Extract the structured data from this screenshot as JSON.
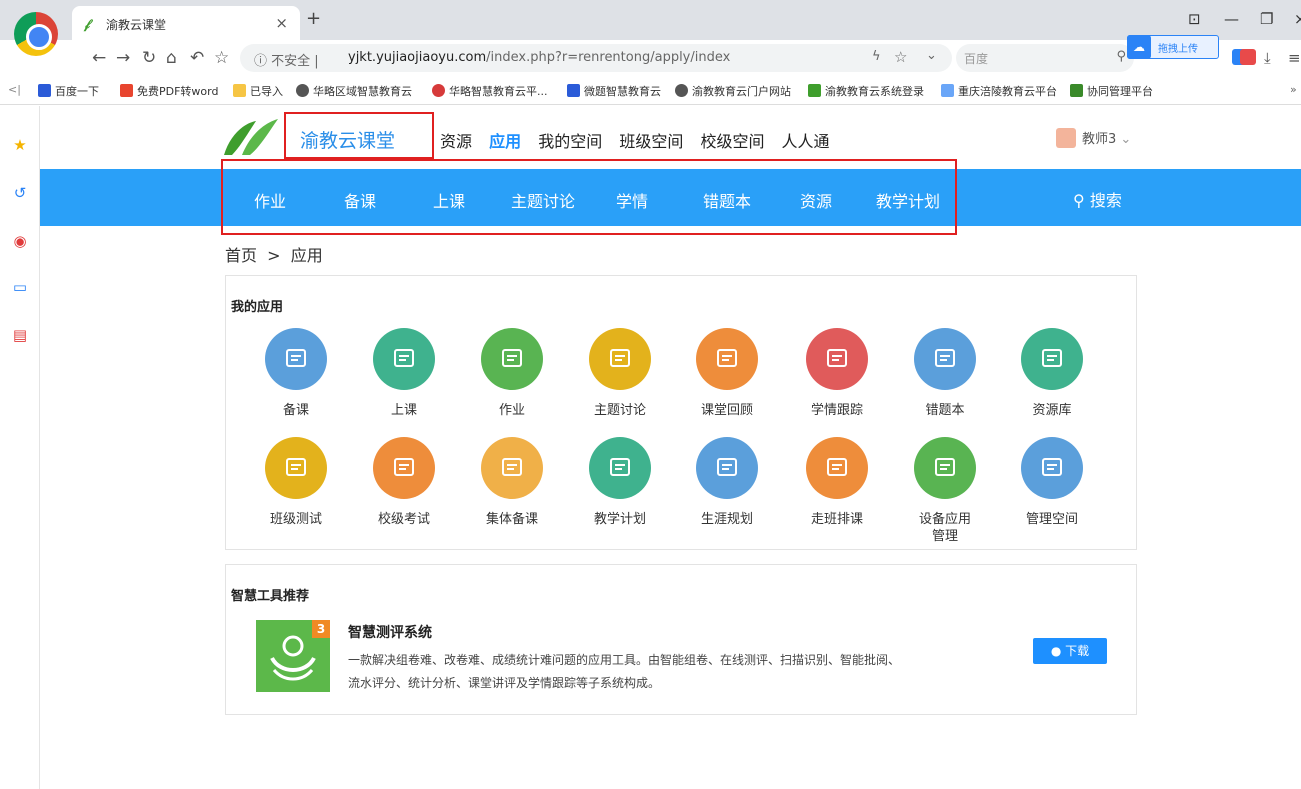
{
  "browser": {
    "tab_title": "渝教云课堂",
    "url_secure_label": "ⓘ 不安全 |",
    "url_domain": "yjkt.yujiaojiaoyu.com",
    "url_path": "/index.php?r=renrentong/apply/index",
    "search_engine": "百度",
    "upload_label": "拖拽上传"
  },
  "bookmarks": [
    "百度一下",
    "免费PDF转word",
    "已导入",
    "华略区域智慧教育云",
    "华略智慧教育云平...",
    "微题智慧教育云",
    "渝教教育云门户网站",
    "渝教教育云系统登录",
    "重庆涪陵教育云平台",
    "协同管理平台"
  ],
  "site": {
    "name": "渝教云课堂",
    "top_nav": [
      "资源",
      "应用",
      "我的空间",
      "班级空间",
      "校级空间",
      "人人通"
    ],
    "active_nav": "应用",
    "user": "教师3",
    "sub_nav": [
      "作业",
      "备课",
      "上课",
      "主题讨论",
      "学情",
      "错题本",
      "资源",
      "教学计划"
    ],
    "search": "搜索",
    "breadcrumb": "首页  >  应用"
  },
  "my_apps": {
    "title": "我的应用",
    "rows": [
      [
        {
          "label": "备课",
          "color": "#5b9fdb",
          "icon": "lesson-prep-icon"
        },
        {
          "label": "上课",
          "color": "#3fb28e",
          "icon": "teaching-icon"
        },
        {
          "label": "作业",
          "color": "#59b452",
          "icon": "homework-icon"
        },
        {
          "label": "主题讨论",
          "color": "#e3b21c",
          "icon": "discussion-icon"
        },
        {
          "label": "课堂回顾",
          "color": "#ee8d3b",
          "icon": "class-review-icon"
        },
        {
          "label": "学情跟踪",
          "color": "#e05b5b",
          "icon": "tracking-icon"
        },
        {
          "label": "错题本",
          "color": "#5b9fdb",
          "icon": "mistake-book-icon"
        },
        {
          "label": "资源库",
          "color": "#3fb28e",
          "icon": "resource-library-icon"
        }
      ],
      [
        {
          "label": "班级测试",
          "color": "#e3b21c",
          "icon": "class-test-icon"
        },
        {
          "label": "校级考试",
          "color": "#ee8d3b",
          "icon": "school-exam-icon"
        },
        {
          "label": "集体备课",
          "color": "#f0b048",
          "icon": "group-prep-icon"
        },
        {
          "label": "教学计划",
          "color": "#3fb28e",
          "icon": "teaching-plan-icon"
        },
        {
          "label": "生涯规划",
          "color": "#5b9fdb",
          "icon": "career-plan-icon"
        },
        {
          "label": "走班排课",
          "color": "#ee8d3b",
          "icon": "schedule-icon"
        },
        {
          "label": "设备应用管理",
          "color": "#59b452",
          "icon": "device-manage-icon"
        },
        {
          "label": "管理空间",
          "color": "#5b9fdb",
          "icon": "manage-space-icon"
        }
      ]
    ]
  },
  "tools": {
    "title": "智慧工具推荐",
    "item": {
      "badge": "3",
      "name": "智慧测评系统",
      "desc_line1": "一款解决组卷难、改卷难、成绩统计难问题的应用工具。由智能组卷、在线测评、扫描识别、智能批阅、",
      "desc_line2": "流水评分、统计分析、课堂讲评及学情跟踪等子系统构成。",
      "download": "● 下载"
    }
  }
}
